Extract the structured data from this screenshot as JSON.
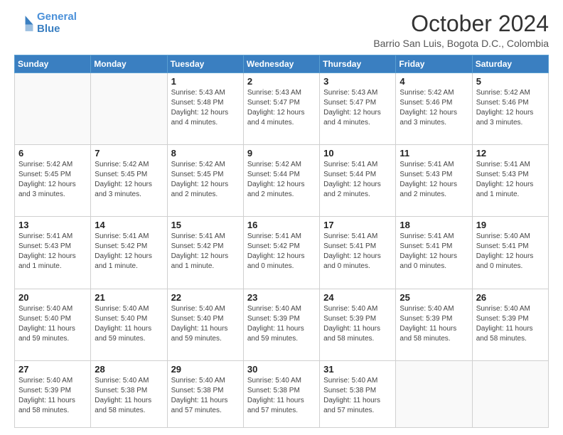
{
  "header": {
    "logo_line1": "General",
    "logo_line2": "Blue",
    "month": "October 2024",
    "location": "Barrio San Luis, Bogota D.C., Colombia"
  },
  "days_of_week": [
    "Sunday",
    "Monday",
    "Tuesday",
    "Wednesday",
    "Thursday",
    "Friday",
    "Saturday"
  ],
  "weeks": [
    [
      {
        "day": "",
        "info": ""
      },
      {
        "day": "",
        "info": ""
      },
      {
        "day": "1",
        "info": "Sunrise: 5:43 AM\nSunset: 5:48 PM\nDaylight: 12 hours\nand 4 minutes."
      },
      {
        "day": "2",
        "info": "Sunrise: 5:43 AM\nSunset: 5:47 PM\nDaylight: 12 hours\nand 4 minutes."
      },
      {
        "day": "3",
        "info": "Sunrise: 5:43 AM\nSunset: 5:47 PM\nDaylight: 12 hours\nand 4 minutes."
      },
      {
        "day": "4",
        "info": "Sunrise: 5:42 AM\nSunset: 5:46 PM\nDaylight: 12 hours\nand 3 minutes."
      },
      {
        "day": "5",
        "info": "Sunrise: 5:42 AM\nSunset: 5:46 PM\nDaylight: 12 hours\nand 3 minutes."
      }
    ],
    [
      {
        "day": "6",
        "info": "Sunrise: 5:42 AM\nSunset: 5:45 PM\nDaylight: 12 hours\nand 3 minutes."
      },
      {
        "day": "7",
        "info": "Sunrise: 5:42 AM\nSunset: 5:45 PM\nDaylight: 12 hours\nand 3 minutes."
      },
      {
        "day": "8",
        "info": "Sunrise: 5:42 AM\nSunset: 5:45 PM\nDaylight: 12 hours\nand 2 minutes."
      },
      {
        "day": "9",
        "info": "Sunrise: 5:42 AM\nSunset: 5:44 PM\nDaylight: 12 hours\nand 2 minutes."
      },
      {
        "day": "10",
        "info": "Sunrise: 5:41 AM\nSunset: 5:44 PM\nDaylight: 12 hours\nand 2 minutes."
      },
      {
        "day": "11",
        "info": "Sunrise: 5:41 AM\nSunset: 5:43 PM\nDaylight: 12 hours\nand 2 minutes."
      },
      {
        "day": "12",
        "info": "Sunrise: 5:41 AM\nSunset: 5:43 PM\nDaylight: 12 hours\nand 1 minute."
      }
    ],
    [
      {
        "day": "13",
        "info": "Sunrise: 5:41 AM\nSunset: 5:43 PM\nDaylight: 12 hours\nand 1 minute."
      },
      {
        "day": "14",
        "info": "Sunrise: 5:41 AM\nSunset: 5:42 PM\nDaylight: 12 hours\nand 1 minute."
      },
      {
        "day": "15",
        "info": "Sunrise: 5:41 AM\nSunset: 5:42 PM\nDaylight: 12 hours\nand 1 minute."
      },
      {
        "day": "16",
        "info": "Sunrise: 5:41 AM\nSunset: 5:42 PM\nDaylight: 12 hours\nand 0 minutes."
      },
      {
        "day": "17",
        "info": "Sunrise: 5:41 AM\nSunset: 5:41 PM\nDaylight: 12 hours\nand 0 minutes."
      },
      {
        "day": "18",
        "info": "Sunrise: 5:41 AM\nSunset: 5:41 PM\nDaylight: 12 hours\nand 0 minutes."
      },
      {
        "day": "19",
        "info": "Sunrise: 5:40 AM\nSunset: 5:41 PM\nDaylight: 12 hours\nand 0 minutes."
      }
    ],
    [
      {
        "day": "20",
        "info": "Sunrise: 5:40 AM\nSunset: 5:40 PM\nDaylight: 11 hours\nand 59 minutes."
      },
      {
        "day": "21",
        "info": "Sunrise: 5:40 AM\nSunset: 5:40 PM\nDaylight: 11 hours\nand 59 minutes."
      },
      {
        "day": "22",
        "info": "Sunrise: 5:40 AM\nSunset: 5:40 PM\nDaylight: 11 hours\nand 59 minutes."
      },
      {
        "day": "23",
        "info": "Sunrise: 5:40 AM\nSunset: 5:39 PM\nDaylight: 11 hours\nand 59 minutes."
      },
      {
        "day": "24",
        "info": "Sunrise: 5:40 AM\nSunset: 5:39 PM\nDaylight: 11 hours\nand 58 minutes."
      },
      {
        "day": "25",
        "info": "Sunrise: 5:40 AM\nSunset: 5:39 PM\nDaylight: 11 hours\nand 58 minutes."
      },
      {
        "day": "26",
        "info": "Sunrise: 5:40 AM\nSunset: 5:39 PM\nDaylight: 11 hours\nand 58 minutes."
      }
    ],
    [
      {
        "day": "27",
        "info": "Sunrise: 5:40 AM\nSunset: 5:39 PM\nDaylight: 11 hours\nand 58 minutes."
      },
      {
        "day": "28",
        "info": "Sunrise: 5:40 AM\nSunset: 5:38 PM\nDaylight: 11 hours\nand 58 minutes."
      },
      {
        "day": "29",
        "info": "Sunrise: 5:40 AM\nSunset: 5:38 PM\nDaylight: 11 hours\nand 57 minutes."
      },
      {
        "day": "30",
        "info": "Sunrise: 5:40 AM\nSunset: 5:38 PM\nDaylight: 11 hours\nand 57 minutes."
      },
      {
        "day": "31",
        "info": "Sunrise: 5:40 AM\nSunset: 5:38 PM\nDaylight: 11 hours\nand 57 minutes."
      },
      {
        "day": "",
        "info": ""
      },
      {
        "day": "",
        "info": ""
      }
    ]
  ]
}
